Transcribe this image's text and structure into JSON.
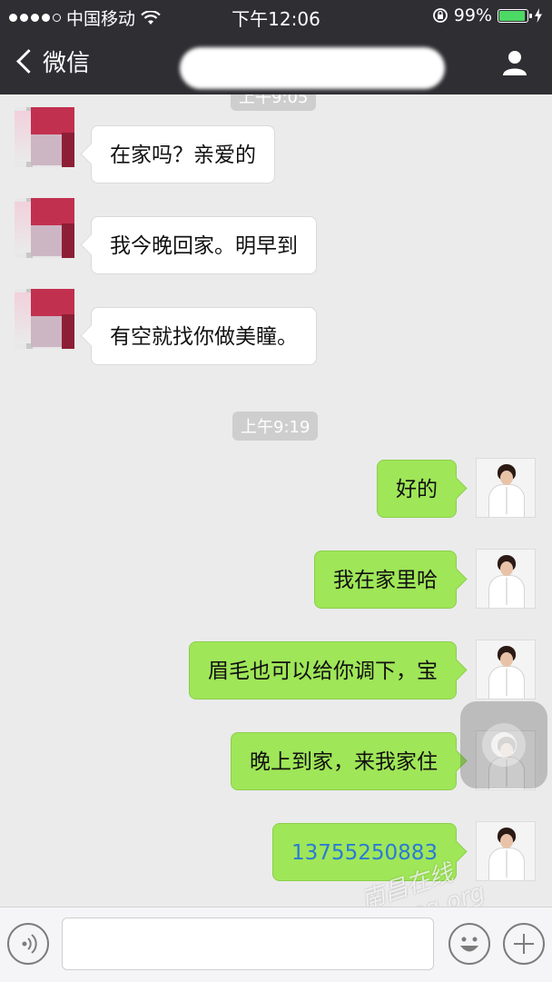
{
  "status_bar": {
    "carrier": "中国移动",
    "time": "下午12:06",
    "battery": "99%",
    "battery_level": 0.99,
    "icons": [
      "signal-dots-icon",
      "wifi-icon",
      "rotation-lock-icon",
      "battery-icon",
      "charging-icon"
    ]
  },
  "nav": {
    "back_label": "微信",
    "icons": [
      "chevron-left-icon",
      "person-icon"
    ]
  },
  "chat": {
    "top_time_fragment": "上午9:05",
    "time_separator": "上午9:19",
    "incoming": [
      {
        "text": "在家吗？亲爱的"
      },
      {
        "text": "我今晚回家。明早到"
      },
      {
        "text": "有空就找你做美瞳。"
      }
    ],
    "outgoing": [
      {
        "text": "好的"
      },
      {
        "text": "我在家里哈"
      },
      {
        "text": "眉毛也可以给你调下，宝"
      },
      {
        "text": "晚上到家，来我家住"
      },
      {
        "text": "13755250883"
      }
    ]
  },
  "watermark": "南昌在线 chang.org",
  "input_bar": {
    "icons": [
      "voice-icon",
      "emoji-icon",
      "plus-icon"
    ],
    "value": ""
  },
  "colors": {
    "nav_bg": "#2e2e33",
    "chat_bg": "#ebebeb",
    "outgoing_bubble": "#9fe658",
    "incoming_bubble": "#ffffff",
    "battery_green": "#4cd964",
    "phone_link": "#2a7ad6"
  }
}
